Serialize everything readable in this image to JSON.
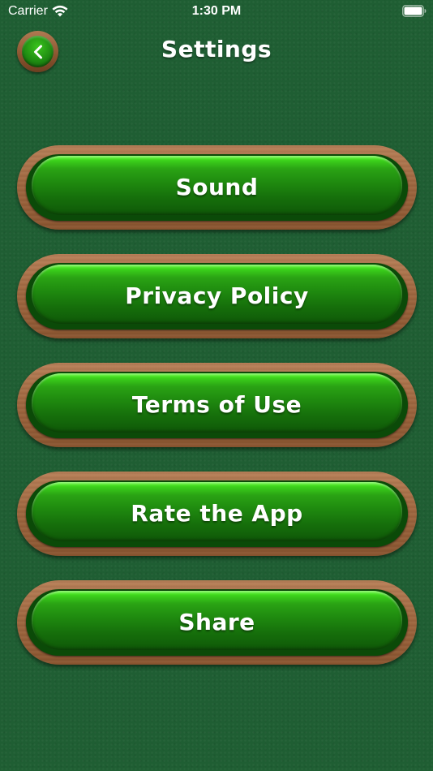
{
  "status_bar": {
    "carrier": "Carrier",
    "time": "1:30 PM",
    "wifi_icon": "wifi-icon",
    "battery_icon": "battery-icon"
  },
  "header": {
    "title": "Settings",
    "back_icon": "chevron-left-icon"
  },
  "menu": {
    "items": [
      {
        "label": "Sound"
      },
      {
        "label": "Privacy Policy"
      },
      {
        "label": "Terms of Use"
      },
      {
        "label": "Rate the App"
      },
      {
        "label": "Share"
      }
    ]
  },
  "colors": {
    "background": "#1f5e33",
    "button_green": "#1f8a0f",
    "button_highlight": "#66ff3a",
    "wood": "#a06840",
    "text": "#ffffff"
  }
}
